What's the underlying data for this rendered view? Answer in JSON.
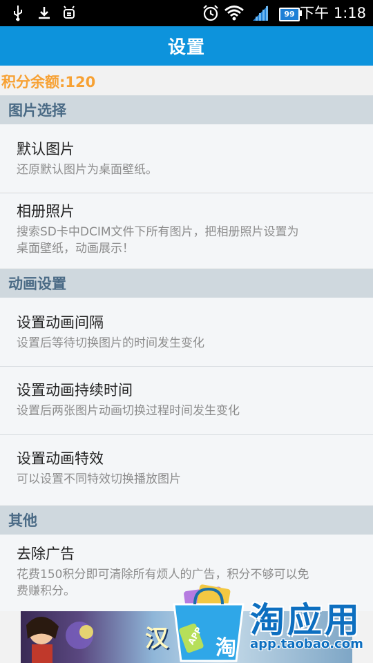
{
  "status_bar": {
    "time": "下午 1:18",
    "battery": "99",
    "icons": [
      "usb-icon",
      "download-icon",
      "android-debug-icon",
      "alarm-icon",
      "wifi-icon",
      "signal-icon",
      "battery-icon"
    ]
  },
  "header": {
    "title": "设置"
  },
  "points_label": "积分余额:120",
  "sections": [
    {
      "title": "图片选择",
      "items": [
        {
          "title": "默认图片",
          "desc": "还原默认图片为桌面壁纸。"
        },
        {
          "title": "相册照片",
          "desc1": "搜索SD卡中DCIM文件下所有图片，把相册照片设置为",
          "desc2": "桌面壁纸，动画展示！"
        }
      ]
    },
    {
      "title": "动画设置",
      "items": [
        {
          "title": "设置动画间隔",
          "desc": "设置后等待切换图片的时间发生变化"
        },
        {
          "title": "设置动画持续时间",
          "desc": "设置后两张图片动画切换过程时间发生变化"
        },
        {
          "title": "设置动画特效",
          "desc": "可以设置不同特效切换播放图片"
        }
      ]
    },
    {
      "title": "其他",
      "items": [
        {
          "title": "去除广告",
          "desc1": "花费150积分即可清除所有烦人的广告，积分不够可以免",
          "desc2": "费赚积分。"
        }
      ]
    }
  ],
  "ad": {
    "game_text": "汉",
    "bag_label": "APP",
    "bag_char": "淘",
    "logo_text": "淘应用",
    "url": "app.taobao.com"
  },
  "colors": {
    "header_bg": "#0d93dc",
    "points": "#f7a133",
    "section_bg": "#cfd8de",
    "section_text": "#4a6a85"
  }
}
